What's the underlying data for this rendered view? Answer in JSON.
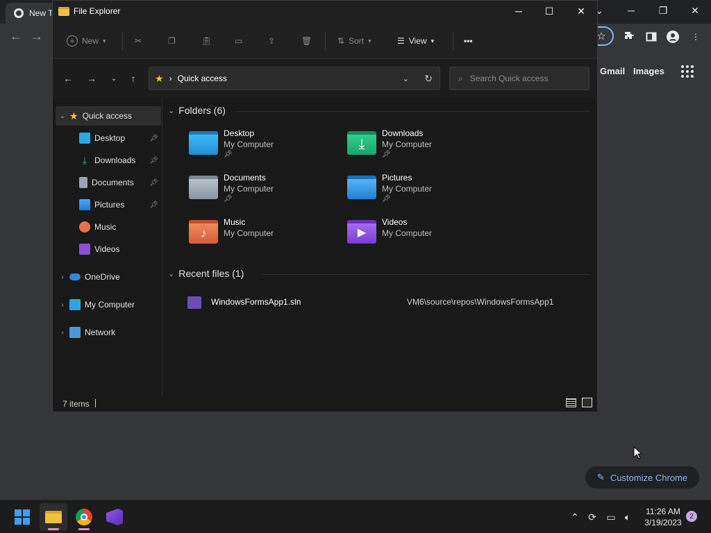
{
  "chrome": {
    "tab_label": "New T",
    "links": {
      "gmail": "Gmail",
      "images": "Images"
    },
    "customize_label": "Customize Chrome",
    "controls": {
      "minimize": "─",
      "maximize": "❐",
      "close": "✕",
      "tab_menu": "⌄"
    }
  },
  "explorer": {
    "title": "File Explorer",
    "controls": {
      "minimize": "─",
      "maximize": "☐",
      "close": "✕"
    },
    "toolbar": {
      "new_label": "New",
      "sort_label": "Sort",
      "view_label": "View",
      "more": "•••"
    },
    "address": {
      "location": "Quick access",
      "separator": "›"
    },
    "search": {
      "placeholder": "Search Quick access"
    },
    "nav": {
      "quick_access": "Quick access",
      "items": [
        {
          "label": "Desktop",
          "pinned": true,
          "icon": "desktop-icon"
        },
        {
          "label": "Downloads",
          "pinned": true,
          "icon": "downloads-icon"
        },
        {
          "label": "Documents",
          "pinned": true,
          "icon": "documents-icon"
        },
        {
          "label": "Pictures",
          "pinned": true,
          "icon": "pictures-icon"
        },
        {
          "label": "Music",
          "pinned": false,
          "icon": "music-icon"
        },
        {
          "label": "Videos",
          "pinned": false,
          "icon": "videos-icon"
        }
      ],
      "onedrive": "OneDrive",
      "my_computer": "My Computer",
      "network": "Network"
    },
    "folders_header": "Folders (6)",
    "folders": [
      {
        "name": "Desktop",
        "location": "My Computer",
        "pinned": true
      },
      {
        "name": "Downloads",
        "location": "My Computer",
        "pinned": true
      },
      {
        "name": "Documents",
        "location": "My Computer",
        "pinned": true
      },
      {
        "name": "Pictures",
        "location": "My Computer",
        "pinned": true
      },
      {
        "name": "Music",
        "location": "My Computer",
        "pinned": false
      },
      {
        "name": "Videos",
        "location": "My Computer",
        "pinned": false
      }
    ],
    "recent_header": "Recent files (1)",
    "recent_files": [
      {
        "name": "WindowsFormsApp1.sln",
        "path": "VM6\\source\\repos\\WindowsFormsApp1"
      }
    ],
    "status": {
      "item_count": "7 items"
    }
  },
  "taskbar": {
    "time": "11:26 AM",
    "date": "3/19/2023",
    "notification_count": "2"
  },
  "colors": {
    "chrome_accent": "#8ab4f8",
    "explorer_bg": "#191919",
    "taskbar_bg": "#1c1c1c",
    "folder_blue": "#1e9be8",
    "downloads_green": "#1fb57c",
    "music_orange": "#e8734a",
    "videos_purple": "#8a4fd8",
    "quick_access_star": "#f5c518"
  }
}
